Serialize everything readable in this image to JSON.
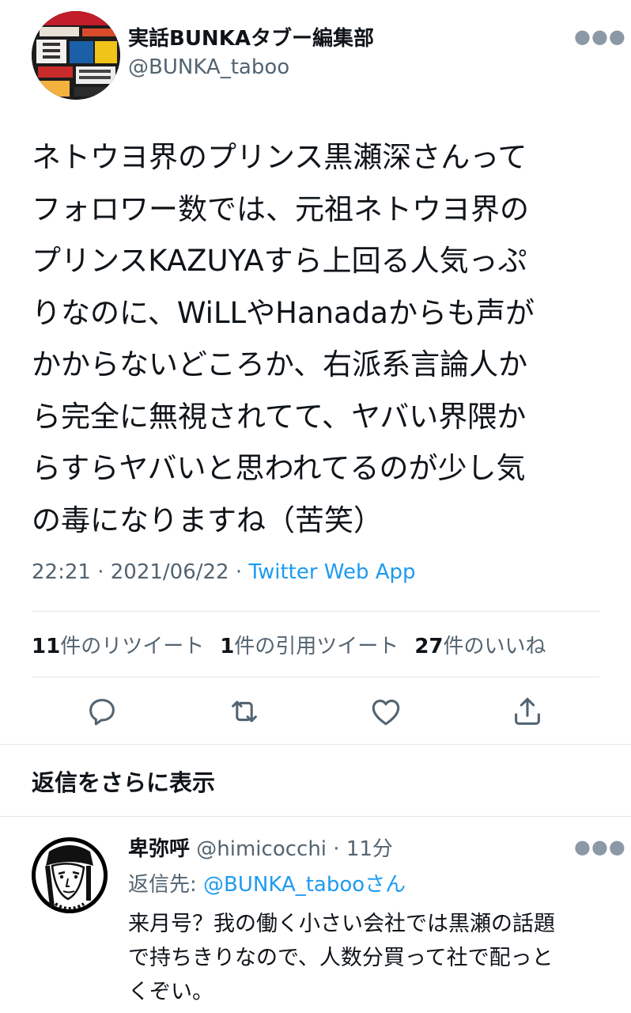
{
  "tweet": {
    "display_name": "実話BUNKAタブー編集部",
    "handle": "@BUNKA_taboo",
    "more_icon": "more-horizontal-icon",
    "text": "ネトウヨ界のプリンス黒瀬深さんって\nフォロワー数では、元祖ネトウヨ界の\nプリンスKAZUYAすら上回る人気っぷ\nりなのに、WiLLやHanadaからも声が\nかからないどころか、右派系言論人か\nら完全に無視されてて、ヤバい界隈か\nらすらヤバいと思われてるのが少し気\nの毒になりますね（苦笑）",
    "time": "22:21",
    "date": "2021/06/22",
    "separator": "·",
    "source_app": "Twitter Web App",
    "stats": {
      "retweets_count": "11",
      "retweets_label": "件のリツイート",
      "quotes_count": "1",
      "quotes_label": "件の引用ツイート",
      "likes_count": "27",
      "likes_label": "件のいいね"
    },
    "actions": [
      "reply-icon",
      "retweet-icon",
      "like-icon",
      "share-icon"
    ]
  },
  "show_more_replies": "返信をさらに表示",
  "reply": {
    "display_name": "卑弥呼",
    "handle": "@himicocchi",
    "separator": "·",
    "time_ago": "11分",
    "reply_to_label": "返信先: ",
    "reply_to_handle": "@BUNKA_taboo",
    "reply_to_suffix": "さん",
    "text": "来月号？我の働く小さい会社では黒瀬の話題\nで持ちきりなので、人数分買って社で配っと\nくぞい。",
    "more_icon": "more-horizontal-icon"
  },
  "colors": {
    "text": "#0f1419",
    "secondary": "#536471",
    "link": "#1d9bf0",
    "divider": "#e1e6ea"
  }
}
